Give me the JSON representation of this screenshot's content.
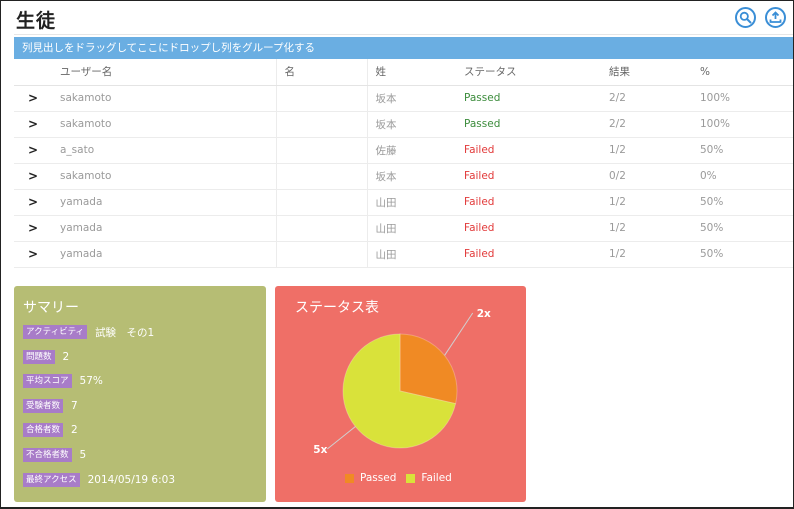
{
  "page": {
    "title": "生徒"
  },
  "toolbar": {
    "search_icon": "search-icon",
    "export_icon": "upload-icon"
  },
  "group_bar": {
    "text": "列見出しをドラッグしてここにドロップし列をグループ化する"
  },
  "table": {
    "headers": [
      "ユーザー名",
      "名",
      "姓",
      "ステータス",
      "結果",
      "%"
    ],
    "rows": [
      {
        "user": "sakamoto",
        "first": "",
        "last": "坂本",
        "status": "Passed",
        "result": "2/2",
        "pct": "100%"
      },
      {
        "user": "sakamoto",
        "first": "",
        "last": "坂本",
        "status": "Passed",
        "result": "2/2",
        "pct": "100%"
      },
      {
        "user": "a_sato",
        "first": "",
        "last": "佐藤",
        "status": "Failed",
        "result": "1/2",
        "pct": "50%"
      },
      {
        "user": "sakamoto",
        "first": "",
        "last": "坂本",
        "status": "Failed",
        "result": "0/2",
        "pct": "0%"
      },
      {
        "user": "yamada",
        "first": "",
        "last": "山田",
        "status": "Failed",
        "result": "1/2",
        "pct": "50%"
      },
      {
        "user": "yamada",
        "first": "",
        "last": "山田",
        "status": "Failed",
        "result": "1/2",
        "pct": "50%"
      },
      {
        "user": "yamada",
        "first": "",
        "last": "山田",
        "status": "Failed",
        "result": "1/2",
        "pct": "50%"
      }
    ],
    "expander_glyph": ">"
  },
  "summary": {
    "title": "サマリー",
    "items": [
      {
        "label": "アクティビティ",
        "value": "試験　その1"
      },
      {
        "label": "問題数",
        "value": "2"
      },
      {
        "label": "平均スコア",
        "value": "57%"
      },
      {
        "label": "受験者数",
        "value": "7"
      },
      {
        "label": "合格者数",
        "value": "2"
      },
      {
        "label": "不合格者数",
        "value": "5"
      },
      {
        "label": "最終アクセス",
        "value": "2014/05/19 6:03"
      }
    ]
  },
  "status_chart": {
    "title": "ステータス表",
    "colors": {
      "card": "#ef6f67",
      "passed": "#f08a24",
      "failed": "#d9e23a"
    }
  },
  "chart_data": {
    "type": "pie",
    "title": "ステータス表",
    "categories": [
      "Passed",
      "Failed"
    ],
    "values": [
      2,
      5
    ],
    "data_labels": [
      "2x",
      "5x"
    ],
    "legend": [
      "Passed",
      "Failed"
    ],
    "legend_position": "bottom"
  }
}
